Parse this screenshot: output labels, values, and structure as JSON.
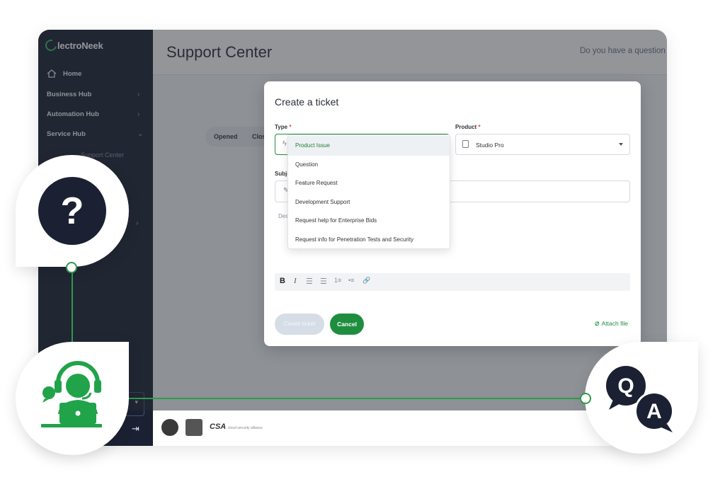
{
  "app": {
    "logo_text": "lectroNeek",
    "page_title": "Support Center",
    "header_question": "Do you have a question"
  },
  "sidebar": {
    "items": [
      {
        "label": "Home",
        "icon": "home-icon"
      },
      {
        "label": "Business Hub",
        "chevron": "›"
      },
      {
        "label": "Automation Hub",
        "chevron": "›"
      },
      {
        "label": "Service Hub",
        "chevron": "⌄"
      }
    ],
    "sub_item": "Support Center",
    "extra_chevron": "›",
    "select_caret": "▾",
    "logout_icon": "⇥"
  },
  "tabs": {
    "opened": "Opened",
    "closed": "Clos"
  },
  "modal": {
    "title": "Create a ticket",
    "type_label": "Type",
    "product_label": "Product",
    "required_mark": "*",
    "product_value": "Studio Pro",
    "subject_label": "Subje",
    "description_label": "Des",
    "toolbar": [
      "B",
      "I",
      "☰",
      "☰",
      "1≡",
      "•≡",
      "🔗"
    ],
    "create_button": "Create ticket",
    "cancel_button": "Cancel",
    "attach_label": "Attach file"
  },
  "type_dropdown": {
    "selected": "Product Issue",
    "options": [
      "Product Issue",
      "Question",
      "Feature Request",
      "Development Support",
      "Request help for Enterprise Bids",
      "Request info for Penetration Tests and Security"
    ]
  },
  "footer": {
    "csa_text": "CSA",
    "csa_small": "cloud security alliance"
  },
  "decor": {
    "question_mark": "?",
    "qa_letters": [
      "Q",
      "A"
    ]
  },
  "colors": {
    "sidebar_bg": "#1b2133",
    "accent_green": "#1e8e3e",
    "line_green": "#2e9b4d"
  }
}
